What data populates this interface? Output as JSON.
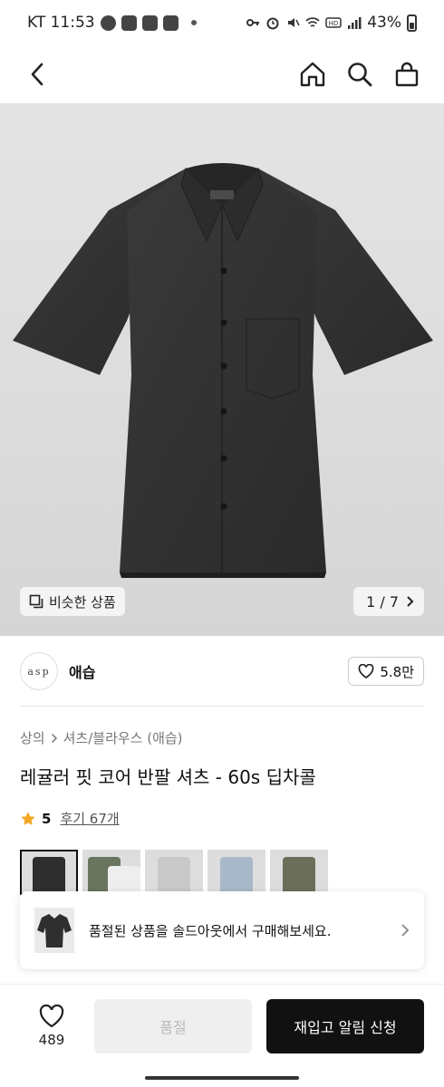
{
  "status_bar": {
    "carrier_time": "KT 11:53",
    "battery": "43%"
  },
  "header": {
    "back_icon": "back-arrow-icon",
    "home_icon": "home-icon",
    "search_icon": "search-icon",
    "cart_icon": "shopping-bag-icon"
  },
  "hero": {
    "similar_label": "비슷한 상품",
    "pager": "1 / 7"
  },
  "brand": {
    "logo_text": "asp",
    "name": "애습",
    "likes": "5.8만"
  },
  "product": {
    "breadcrumb": [
      "상의",
      "셔츠/블라우스 (애습)"
    ],
    "title": "레귤러 핏 코어 반팔 셔츠 - 60s 딥차콜",
    "rating": "5",
    "review_label": "후기 67개"
  },
  "thumbnails": [
    {
      "color": "#2e2e2e",
      "selected": true
    },
    {
      "color": "#6a7560",
      "selected": false
    },
    {
      "color": "#c9c9c9",
      "selected": false
    },
    {
      "color": "#a9b8c9",
      "selected": false
    },
    {
      "color": "#6b6f5a",
      "selected": false
    }
  ],
  "soldout_banner": {
    "message": "품절된 상품을 솔드아웃에서 구매해보세요."
  },
  "bottom_bar": {
    "wish_count": "489",
    "soldout_label": "품절",
    "notify_label": "재입고 알림 신청"
  },
  "colors": {
    "accent_star": "#f5a623",
    "primary_button": "#111111"
  }
}
